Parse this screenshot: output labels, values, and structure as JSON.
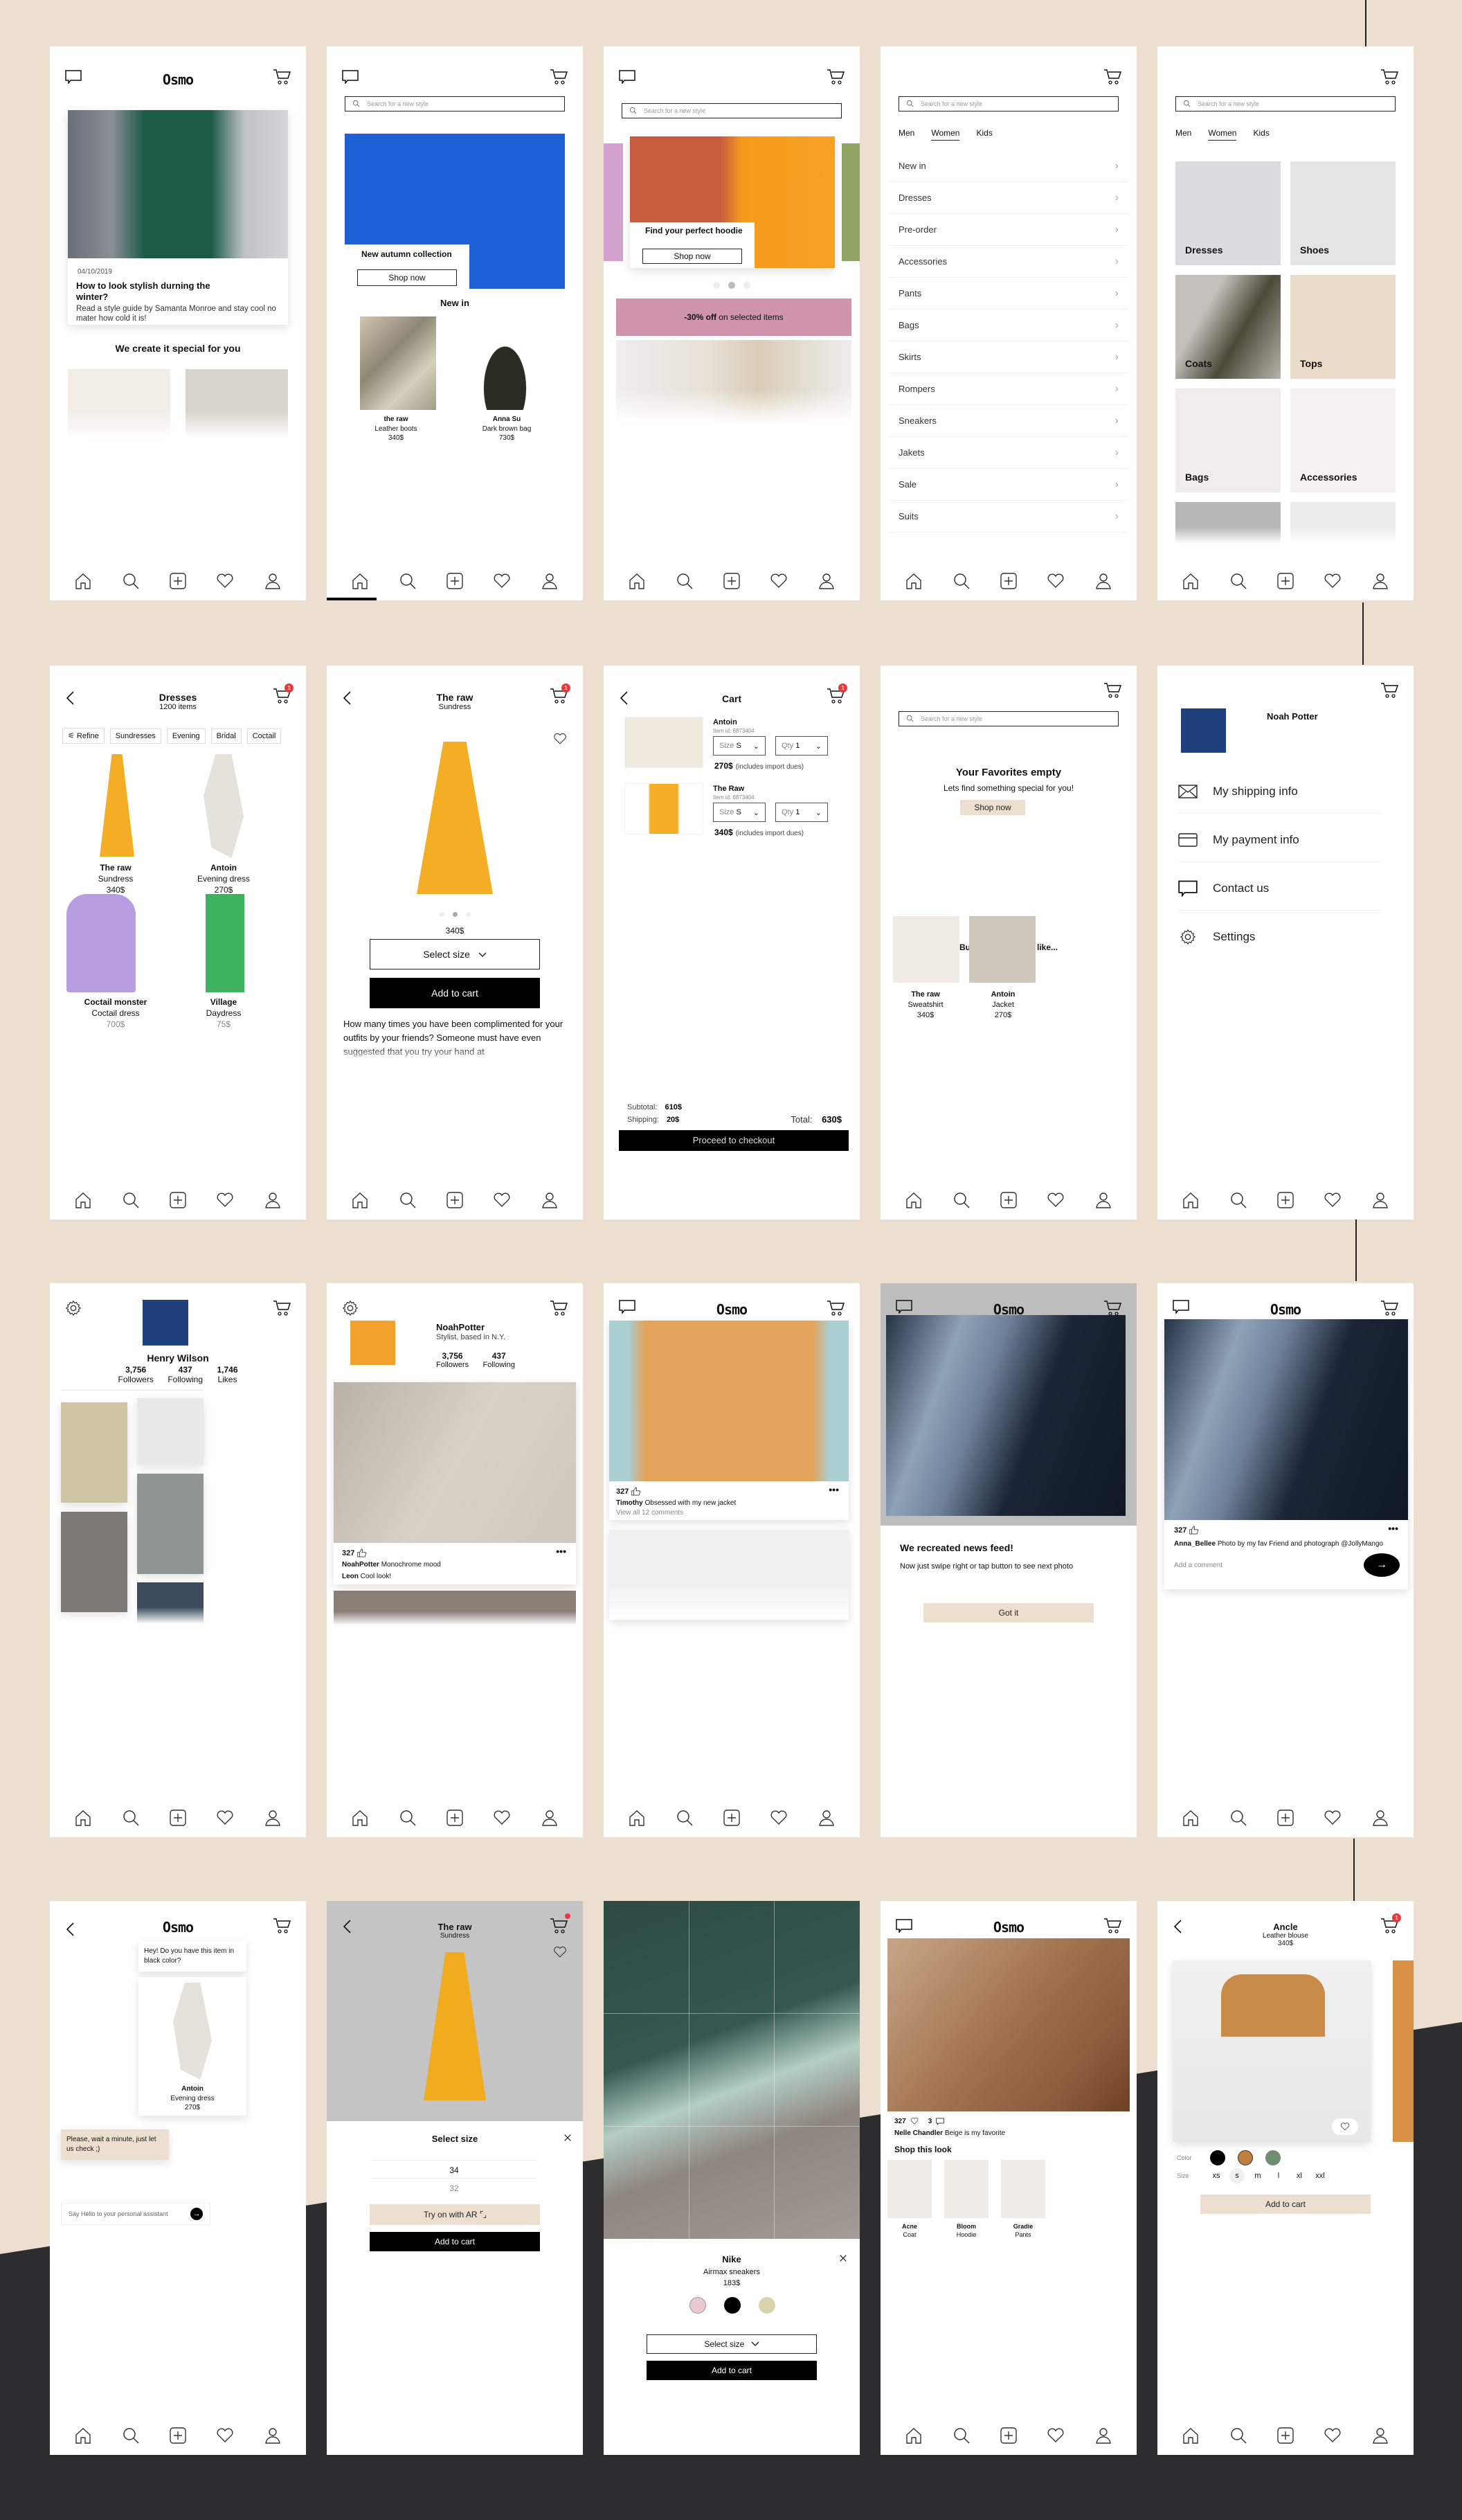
{
  "app": {
    "name": "Osmo"
  },
  "common": {
    "search_placeholder": "Search for a new style",
    "shop_now": "Shop now",
    "add_to_cart": "Add to cart",
    "select_size": "Select size",
    "cart_badge": "1"
  },
  "colors": {
    "beige": "#ecdfcf",
    "black": "#000000",
    "badge_red": "#e8383d",
    "dark_bg": "#2d2d30"
  },
  "nav_items": [
    "home-icon",
    "search-icon",
    "add-icon",
    "heart-icon",
    "profile-icon"
  ],
  "s1": {
    "date": "04/10/2019",
    "headline": "How to look stylish durning the winter?",
    "body": "Read a style guide by Samanta Monroe and stay cool no mater how cold it is!",
    "section": "We create it special for you"
  },
  "s2": {
    "hero_title": "New autumn collection",
    "section": "New in",
    "products": [
      {
        "brand": "the raw",
        "name": "Leather boots",
        "price": "340$"
      },
      {
        "brand": "Anna Su",
        "name": "Dark brown bag",
        "price": "730$"
      }
    ]
  },
  "s3": {
    "hero_title": "Find your perfect hoodie",
    "promo_bold": "-30% off",
    "promo_rest": " on selected items",
    "carousel": {
      "count": 3,
      "active": 2
    }
  },
  "tabs": [
    "Men",
    "Women",
    "Kids"
  ],
  "active_tab": "Women",
  "s4": {
    "categories": [
      "New in",
      "Dresses",
      "Pre-order",
      "Accessories",
      "Pants",
      "Bags",
      "Skirts",
      "Rompers",
      "Sneakers",
      "Jakets",
      "Sale",
      "Suits"
    ]
  },
  "s5": {
    "tiles": [
      "Dresses",
      "Shoes",
      "Coats",
      "Tops",
      "Bags",
      "Accessories"
    ]
  },
  "s6": {
    "title": "Dresses",
    "count": "1200 items",
    "chips": [
      "Refine",
      "Sundresses",
      "Evening",
      "Bridal",
      "Coctail"
    ],
    "products": [
      {
        "brand": "The raw",
        "name": "Sundress",
        "price": "340$"
      },
      {
        "brand": "Antoin",
        "name": "Evening dress",
        "price": "270$"
      },
      {
        "brand": "Coctail monster",
        "name": "Coctail dress",
        "price": "700$"
      },
      {
        "brand": "Village",
        "name": "Daydress",
        "price": "75$"
      }
    ]
  },
  "s7": {
    "brand": "The raw",
    "name": "Sundress",
    "price": "340$",
    "description": "How many times you have been complimented for your outfits by your friends? Someone must have even suggested that you try your hand at"
  },
  "s8": {
    "title": "Cart",
    "items": [
      {
        "brand": "Antoin",
        "item_id": "Item id: 6873404",
        "size_label": "Size",
        "size": "S",
        "qty_label": "Qty",
        "qty": "1",
        "price": "270$",
        "note": "(includes import dues)"
      },
      {
        "brand": "The Raw",
        "item_id": "Item id: 6873404",
        "size_label": "Size",
        "size": "S",
        "qty_label": "Qty",
        "qty": "1",
        "price": "340$",
        "note": "(includes import dues)"
      }
    ],
    "subtotal_label": "Subtotal:",
    "subtotal": "610$",
    "shipping_label": "Shipping:",
    "shipping": "20$",
    "total_label": "Total:",
    "total": "630$",
    "checkout": "Proceed to checkout"
  },
  "s9": {
    "title": "Your Favorites empty",
    "subtitle": "Lets find something special for you!",
    "section": "But maybe you will like...",
    "products": [
      {
        "brand": "The raw",
        "name": "Sweatshirt",
        "price": "340$"
      },
      {
        "brand": "Antoin",
        "name": "Jacket",
        "price": "270$"
      }
    ]
  },
  "s10": {
    "name": "Noah Potter",
    "menu": [
      "My shipping info",
      "My payment info",
      "Contact us",
      "Settings"
    ]
  },
  "s11": {
    "name": "Henry Wilson",
    "stats": [
      {
        "value": "3,756",
        "label": "Followers"
      },
      {
        "value": "437",
        "label": "Following"
      },
      {
        "value": "1,746",
        "label": "Likes"
      }
    ]
  },
  "s12": {
    "name": "NoahPotter",
    "bio": "Stylist, based in N.Y.",
    "stats": [
      {
        "value": "3,756",
        "label": "Followers"
      },
      {
        "value": "437",
        "label": "Following"
      }
    ],
    "likes": "327",
    "caption_user": "NoahPotter",
    "caption": "Monochrome mood",
    "comment_user": "Leon",
    "comment": "Cool look!"
  },
  "s13": {
    "likes": "327",
    "caption_user": "Timothy",
    "caption": "Obsessed with my new jacket",
    "view_comments": "View all 12 comments"
  },
  "s14": {
    "title": "We recreated news feed!",
    "body": "Now just swipe right or tap button to see next photo",
    "button": "Got it"
  },
  "s15": {
    "likes": "327",
    "caption_user": "Anna_Bellee",
    "caption": "Photo by my fav Friend and photograph @JollyMango",
    "comment_placeholder": "Add a comment"
  },
  "s16": {
    "msg1": "Hey! Do you have this item in black color?",
    "product": {
      "brand": "Antoin",
      "name": "Evening dress",
      "price": "270$"
    },
    "msg2": "Please, wait a minute, just let us check ;)",
    "input_placeholder": "Say Hello to your personal assistant"
  },
  "s17": {
    "brand": "The raw",
    "name": "Sundress",
    "sheet_title": "Select size",
    "sizes": [
      "34",
      "32"
    ],
    "selected_size": "34",
    "ar_button": "Try on with AR"
  },
  "s18": {
    "brand": "Nike",
    "name": "Airmax sneakers",
    "price": "183$",
    "colors": [
      "#e9c9cf",
      "#000000",
      "#d9d3ac"
    ]
  },
  "s19": {
    "likes": "327",
    "comments": "3",
    "caption_user": "Nelle Chandler",
    "caption": "Beige is my favorite",
    "section": "Shop this look",
    "products": [
      {
        "brand": "Acne",
        "name": "Coat"
      },
      {
        "brand": "Bloom",
        "name": "Hoodie"
      },
      {
        "brand": "Gradie",
        "name": "Pants"
      }
    ]
  },
  "s20": {
    "brand": "Ancle",
    "name": "Leather blouse",
    "price": "340$",
    "color_label": "Color",
    "size_label": "Size",
    "colors": [
      "#000000",
      "#c17f3e",
      "#6f8e71"
    ],
    "sizes": [
      "xs",
      "s",
      "m",
      "l",
      "xl",
      "xxl"
    ],
    "selected_size": "s"
  }
}
